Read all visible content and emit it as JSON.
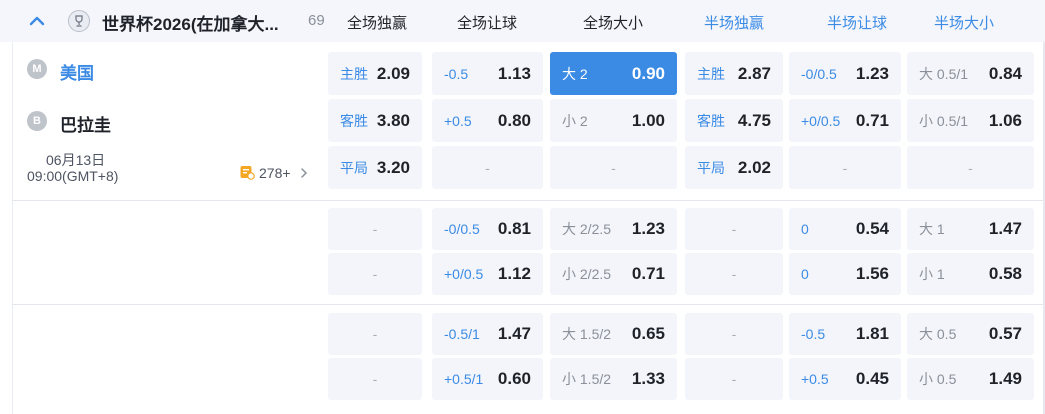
{
  "league": {
    "name": "世界杯2026(在加拿大...",
    "count": "69",
    "icon": "trophy-badge-icon"
  },
  "columns": {
    "full_time": [
      "全场独赢",
      "全场让球",
      "全场大小"
    ],
    "half_time": [
      "半场独赢",
      "半场让球",
      "半场大小"
    ]
  },
  "match": {
    "home": {
      "badge": "M",
      "name": "美国"
    },
    "away": {
      "badge": "B",
      "name": "巴拉圭"
    },
    "date": "06月13日",
    "time": "09:00(GMT+8)",
    "more_count": "278+"
  },
  "odds": {
    "r1": {
      "c1": {
        "label": "主胜",
        "value": "2.09"
      },
      "c2": {
        "label": "-0.5",
        "value": "1.13"
      },
      "c3": {
        "label": "大 2",
        "value": "0.90"
      },
      "c4": {
        "label": "主胜",
        "value": "2.87"
      },
      "c5": {
        "label": "-0/0.5",
        "value": "1.23"
      },
      "c6": {
        "label": "大 0.5/1",
        "value": "0.84"
      }
    },
    "r2": {
      "c1": {
        "label": "客胜",
        "value": "3.80"
      },
      "c2": {
        "label": "+0.5",
        "value": "0.80"
      },
      "c3": {
        "label": "小 2",
        "value": "1.00"
      },
      "c4": {
        "label": "客胜",
        "value": "4.75"
      },
      "c5": {
        "label": "+0/0.5",
        "value": "0.71"
      },
      "c6": {
        "label": "小 0.5/1",
        "value": "1.06"
      }
    },
    "r3": {
      "c1": {
        "label": "平局",
        "value": "3.20"
      },
      "c2": {
        "dash": "-"
      },
      "c3": {
        "dash": "-"
      },
      "c4": {
        "label": "平局",
        "value": "2.02"
      },
      "c5": {
        "dash": "-"
      },
      "c6": {
        "dash": "-"
      }
    },
    "r4": {
      "c1": {
        "dash": "-"
      },
      "c2": {
        "label": "-0/0.5",
        "value": "0.81"
      },
      "c3": {
        "label": "大 2/2.5",
        "value": "1.23"
      },
      "c4": {
        "dash": "-"
      },
      "c5": {
        "label": "0",
        "value": "0.54"
      },
      "c6": {
        "label": "大 1",
        "value": "1.47"
      }
    },
    "r5": {
      "c1": {
        "dash": "-"
      },
      "c2": {
        "label": "+0/0.5",
        "value": "1.12"
      },
      "c3": {
        "label": "小 2/2.5",
        "value": "0.71"
      },
      "c4": {
        "dash": "-"
      },
      "c5": {
        "label": "0",
        "value": "1.56"
      },
      "c6": {
        "label": "小 1",
        "value": "0.58"
      }
    },
    "r6": {
      "c1": {
        "dash": "-"
      },
      "c2": {
        "label": "-0.5/1",
        "value": "1.47"
      },
      "c3": {
        "label": "大 1.5/2",
        "value": "0.65"
      },
      "c4": {
        "dash": "-"
      },
      "c5": {
        "label": "-0.5",
        "value": "1.81"
      },
      "c6": {
        "label": "大 0.5",
        "value": "0.57"
      }
    },
    "r7": {
      "c1": {
        "dash": "-"
      },
      "c2": {
        "label": "+0.5/1",
        "value": "0.60"
      },
      "c3": {
        "label": "小 1.5/2",
        "value": "1.33"
      },
      "c4": {
        "dash": "-"
      },
      "c5": {
        "label": "+0.5",
        "value": "0.45"
      },
      "c6": {
        "label": "小 0.5",
        "value": "1.49"
      }
    }
  },
  "selected_cell": "r1.c3",
  "colors": {
    "accent": "#3b8be5",
    "cell_bg": "#f3f5fa",
    "header_bg": "#f4f6fb"
  }
}
